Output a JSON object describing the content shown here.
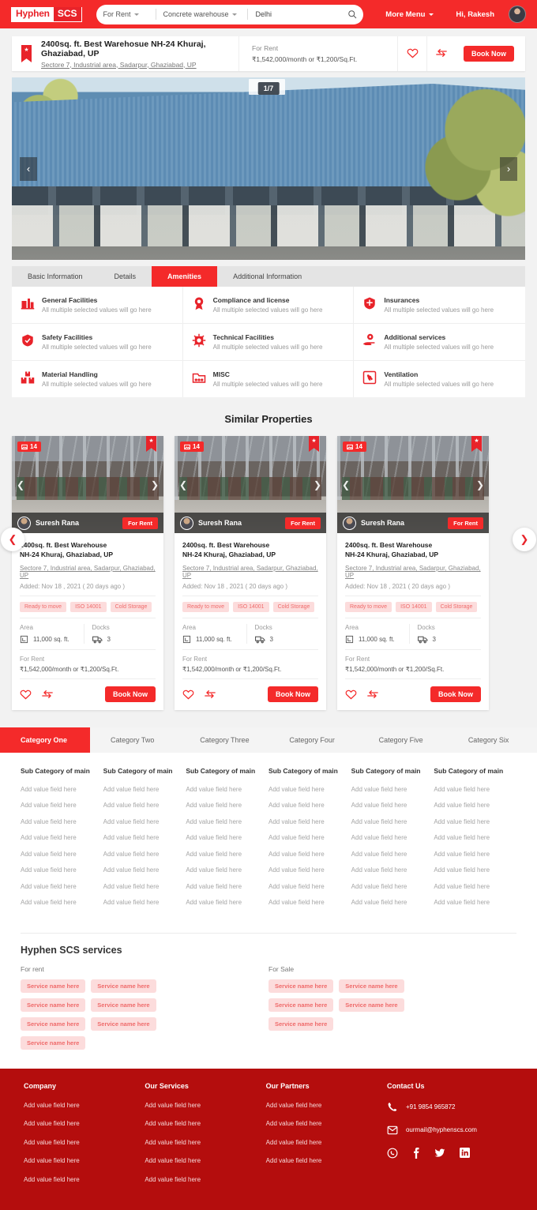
{
  "header": {
    "logo_part1": "Hyphen",
    "logo_part2": "SCS",
    "search": {
      "type_value": "For Rent",
      "category_value": "Concrete warehouse",
      "location_value": "Delhi",
      "location_placeholder": "Delhi"
    },
    "more_menu": "More Menu",
    "greeting": "Hi, Rakesh"
  },
  "property_bar": {
    "title": "2400sq. ft. Best Warehosue NH-24 Khuraj, Ghaziabad, UP",
    "address": "Sectore 7, Industrial area, Sadarpur, Ghaziabad, UP",
    "price_label": "For Rent",
    "price_value": "₹1,542,000/month  or  ₹1,200/Sq.Ft.",
    "book_label": "Book Now"
  },
  "hero": {
    "counter": "1/7"
  },
  "tabs": [
    {
      "label": "Basic Information",
      "active": false
    },
    {
      "label": "Details",
      "active": false
    },
    {
      "label": "Amenities",
      "active": true
    },
    {
      "label": "Additional Information",
      "active": false
    }
  ],
  "amenities": [
    {
      "icon": "general-facilities-icon",
      "title": "General Facilities",
      "desc": "All multiple selected values will go here"
    },
    {
      "icon": "compliance-license-icon",
      "title": "Compliance and license",
      "desc": "All multiple selected values will go here"
    },
    {
      "icon": "insurance-shield-icon",
      "title": "Insurances",
      "desc": "All multiple selected values will go here"
    },
    {
      "icon": "safety-shield-check-icon",
      "title": "Safety Facilities",
      "desc": "All multiple selected values will go here"
    },
    {
      "icon": "technical-chip-icon",
      "title": "Technical Facilities",
      "desc": "All multiple selected values will go here"
    },
    {
      "icon": "additional-services-hand-icon",
      "title": "Additional services",
      "desc": "All multiple selected values will go here"
    },
    {
      "icon": "material-handling-boxes-icon",
      "title": "Material Handling",
      "desc": "All multiple selected values will go here"
    },
    {
      "icon": "misc-folder-icon",
      "title": "MISC",
      "desc": "All multiple selected values will go here"
    },
    {
      "icon": "ventilation-fan-icon",
      "title": "Ventilation",
      "desc": "All multiple selected values will go here"
    }
  ],
  "similar": {
    "heading": "Similar Properties",
    "cards": [
      {
        "photo_count": "14",
        "agent": "Suresh Rana",
        "status": "For Rent",
        "title": "2400sq. ft. Best Warehouse\nNH-24 Khuraj, Ghaziabad, UP",
        "address": "Sectore 7, Industrial area, Sadarpur, Ghaziabad, UP",
        "added": "Added: Nov 18 , 2021 ( 20 days ago )",
        "tags": [
          "Ready to move",
          "ISO 14001",
          "Cold Storage"
        ],
        "area_label": "Area",
        "area_value": "11,000 sq. ft.",
        "docks_label": "Docks",
        "docks_value": "3",
        "price_label": "For Rent",
        "price_value": "₹1,542,000/month  or  ₹1,200/Sq.Ft.",
        "book_label": "Book Now"
      },
      {
        "photo_count": "14",
        "agent": "Suresh Rana",
        "status": "For Rent",
        "title": "2400sq. ft. Best Warehouse\nNH-24 Khuraj, Ghaziabad, UP",
        "address": "Sectore 7, Industrial area, Sadarpur, Ghaziabad, UP",
        "added": "Added: Nov 18 , 2021 ( 20 days ago )",
        "tags": [
          "Ready to move",
          "ISO 14001",
          "Cold Storage"
        ],
        "area_label": "Area",
        "area_value": "11,000 sq. ft.",
        "docks_label": "Docks",
        "docks_value": "3",
        "price_label": "For Rent",
        "price_value": "₹1,542,000/month  or  ₹1,200/Sq.Ft.",
        "book_label": "Book Now"
      },
      {
        "photo_count": "14",
        "agent": "Suresh Rana",
        "status": "For Rent",
        "title": "2400sq. ft. Best Warehouse\nNH-24 Khuraj, Ghaziabad, UP",
        "address": "Sectore 7, Industrial area, Sadarpur, Ghaziabad, UP",
        "added": "Added: Nov 18 , 2021 ( 20 days ago )",
        "tags": [
          "Ready to move",
          "ISO 14001",
          "Cold Storage"
        ],
        "area_label": "Area",
        "area_value": "11,000 sq. ft.",
        "docks_label": "Docks",
        "docks_value": "3",
        "price_label": "For Rent",
        "price_value": "₹1,542,000/month  or  ₹1,200/Sq.Ft.",
        "book_label": "Book Now"
      }
    ]
  },
  "categories": {
    "tabs": [
      {
        "label": "Category One",
        "active": true
      },
      {
        "label": "Category Two",
        "active": false
      },
      {
        "label": "Category Three",
        "active": false
      },
      {
        "label": "Category Four",
        "active": false
      },
      {
        "label": "Category Five",
        "active": false
      },
      {
        "label": "Category Six",
        "active": false
      }
    ],
    "sub_header": "Sub Category of main",
    "value_text": "Add value field here",
    "rows_per_column": 8
  },
  "services": {
    "heading": "Hyphen SCS services",
    "for_rent_label": "For rent",
    "for_sale_label": "For Sale",
    "chip_label": "Service name here",
    "for_rent_count": 7,
    "for_sale_count": 5
  },
  "footer": {
    "columns": [
      {
        "heading": "Company",
        "items": [
          "Add value field here",
          "Add value field here",
          "Add value field here",
          "Add value field here",
          "Add value field here"
        ]
      },
      {
        "heading": "Our Services",
        "items": [
          "Add value field here",
          "Add value field here",
          "Add value field here",
          "Add value field here",
          "Add value field here"
        ]
      },
      {
        "heading": "Our Partners",
        "items": [
          "Add value field here",
          "Add value field here",
          "Add value field here",
          "Add value field here"
        ]
      }
    ],
    "contact": {
      "heading": "Contact Us",
      "phone": "+91 9854 965872",
      "email": "ourmail@hyphenscs.com",
      "social": [
        "whatsapp-icon",
        "facebook-icon",
        "twitter-icon",
        "linkedin-icon"
      ]
    }
  },
  "colors": {
    "brand_red": "#f42a2a",
    "dark_red": "#b40d0d",
    "chip_bg": "#fcdcdc",
    "chip_text": "#ef6b6b"
  }
}
